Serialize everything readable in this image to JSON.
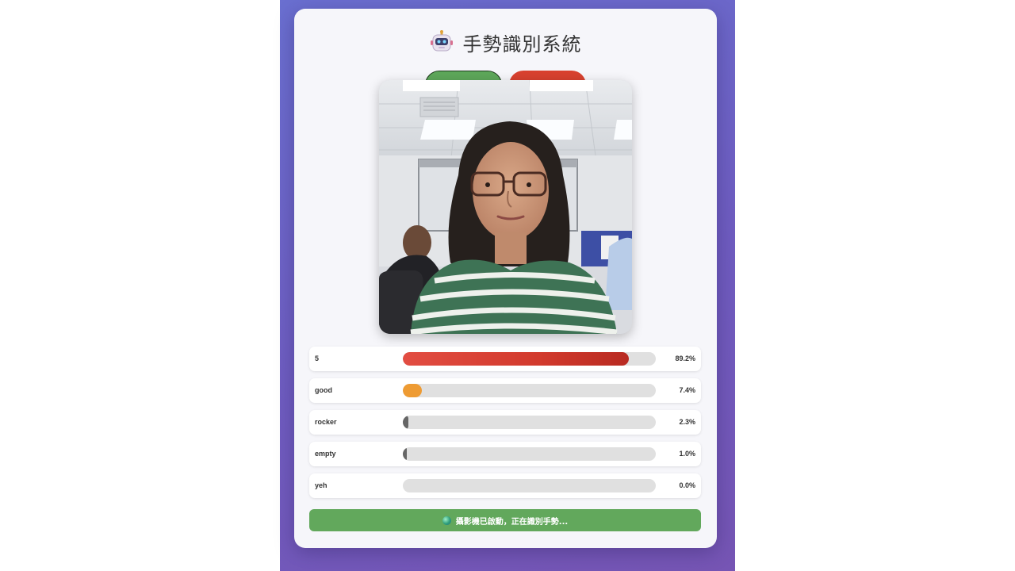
{
  "app": {
    "title": "手勢識別系統",
    "icon": "robot-icon"
  },
  "controls": {
    "start_button_color": "#5da75a",
    "stop_button_color": "#d8412f"
  },
  "camera": {
    "feed": "webcam-video"
  },
  "predictions": [
    {
      "label": "5",
      "percent": "89.2%",
      "value": 0.892,
      "color": "#d23a2d"
    },
    {
      "label": "good",
      "percent": "7.4%",
      "value": 0.074,
      "color": "#ee9b33"
    },
    {
      "label": "rocker",
      "percent": "2.3%",
      "value": 0.023,
      "color": "#666666"
    },
    {
      "label": "empty",
      "percent": "1.0%",
      "value": 0.01,
      "color": "#666666"
    },
    {
      "label": "yeh",
      "percent": "0.0%",
      "value": 0.0,
      "color": "#666666"
    }
  ],
  "status": {
    "text": "攝影機已啟動，正在識別手勢...",
    "color": "#62a85c"
  }
}
